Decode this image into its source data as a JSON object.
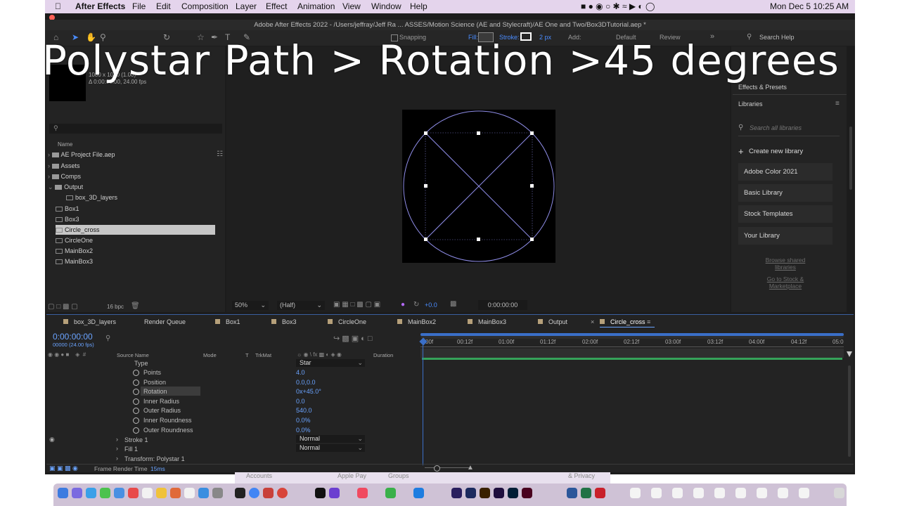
{
  "menubar": {
    "app_name": "After Effects",
    "items": [
      "File",
      "Edit",
      "Composition",
      "Layer",
      "Effect",
      "Animation",
      "View",
      "Window",
      "Help"
    ],
    "clock": "Mon Dec 5  10:25 AM"
  },
  "window_title": "Adobe After Effects 2022 - /Users/jeffray/Jeff Ra ... ASSES/Motion Science (AE and Stylecraft)/AE One and Two/Box3DTutorial.aep *",
  "toolbar": {
    "snapping": "Snapping",
    "fill": "Fill:",
    "stroke": "Stroke:",
    "stroke_width": "2 px",
    "add": "Add:",
    "workspace_default": "Default",
    "workspace_review": "Review",
    "search_help": "Search Help"
  },
  "caption": "Polystar Path > Rotation >45 degrees",
  "project": {
    "meta_line1": "1080 x 1080 (1.00)",
    "meta_line2": "Δ 0:00:05:00, 24.00 fps",
    "column_name": "Name",
    "items": [
      {
        "name": "AE Project File.aep",
        "kind": "folder",
        "indent": 0
      },
      {
        "name": "Assets",
        "kind": "folder",
        "indent": 0
      },
      {
        "name": "Comps",
        "kind": "folder",
        "indent": 0
      },
      {
        "name": "Output",
        "kind": "folder",
        "indent": 0
      },
      {
        "name": "box_3D_layers",
        "kind": "comp",
        "indent": 1
      },
      {
        "name": "Box1",
        "kind": "comp",
        "indent": 0
      },
      {
        "name": "Box3",
        "kind": "comp",
        "indent": 0
      },
      {
        "name": "Circle_cross",
        "kind": "comp",
        "indent": 0,
        "selected": true
      },
      {
        "name": "CircleOne",
        "kind": "comp",
        "indent": 0
      },
      {
        "name": "MainBox2",
        "kind": "comp",
        "indent": 0
      },
      {
        "name": "MainBox3",
        "kind": "comp",
        "indent": 0
      }
    ],
    "bpc": "16 bpc"
  },
  "viewer": {
    "zoom": "50%",
    "resolution": "(Half)",
    "exposure": "+0.0",
    "timecode": "0:00:00:00"
  },
  "right_panel": {
    "effects_presets": "Effects & Presets",
    "libraries": "Libraries",
    "search_placeholder": "Search all libraries",
    "create_library": "Create new library",
    "libraries_list": [
      "Adobe Color 2021",
      "Basic Library",
      "Stock Templates",
      "Your Library"
    ],
    "browse_shared": "Browse shared libraries",
    "go_to_stock": "Go to Stock & Marketplace"
  },
  "timeline": {
    "tabs": [
      "box_3D_layers",
      "Render Queue",
      "Box1",
      "Box3",
      "CircleOne",
      "MainBox2",
      "MainBox3",
      "Output",
      "Circle_cross"
    ],
    "active_tab": "Circle_cross",
    "current_time": "0:00:00:00",
    "frames": "00000 (24.00 fps)",
    "columns": {
      "source": "Source Name",
      "mode": "Mode",
      "t": "T",
      "trkmat": "TrkMat",
      "duration": "Duration"
    },
    "ruler": [
      "00f",
      "00:12f",
      "01:00f",
      "01:12f",
      "02:00f",
      "02:12f",
      "03:00f",
      "03:12f",
      "04:00f",
      "04:12f",
      "05:0"
    ],
    "properties": [
      {
        "label": "Type",
        "value": "Star"
      },
      {
        "label": "Points",
        "value": "4.0"
      },
      {
        "label": "Position",
        "value": "0.0,0.0"
      },
      {
        "label": "Rotation",
        "value": "0x+45.0°"
      },
      {
        "label": "Inner Radius",
        "value": "0.0"
      },
      {
        "label": "Outer Radius",
        "value": "540.0"
      },
      {
        "label": "Inner Roundness",
        "value": "0.0%"
      },
      {
        "label": "Outer Roundness",
        "value": "0.0%"
      }
    ],
    "groups": [
      {
        "label": "Stroke 1",
        "mode": "Normal"
      },
      {
        "label": "Fill 1",
        "mode": "Normal"
      },
      {
        "label": "Transform: Polystar 1",
        "mode": ""
      }
    ],
    "frame_render_label": "Frame Render Time",
    "frame_render_value": "15ms"
  },
  "dock_peek": [
    "Accounts",
    "Apple Pay",
    "Groups",
    "& Privacy"
  ]
}
